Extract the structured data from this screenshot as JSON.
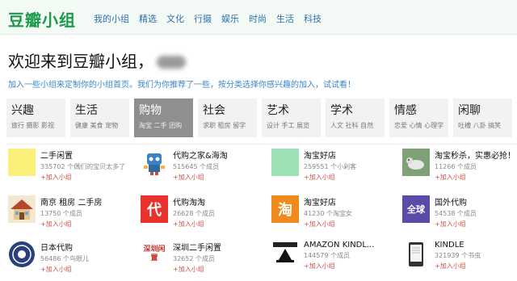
{
  "header": {
    "logo": "豆瓣小组",
    "nav": [
      "我的小组",
      "精选",
      "文化",
      "行摄",
      "娱乐",
      "时尚",
      "生活",
      "科技"
    ]
  },
  "welcome": {
    "title": "欢迎来到豆瓣小组，",
    "subtitle": "加入一些小组来定制你的小组首页。我们为你推荐了一些，按分类选择你感兴趣的加入，试试看！"
  },
  "categories": [
    {
      "name": "兴趣",
      "tags": "旅行 摄影 影视",
      "active": false
    },
    {
      "name": "生活",
      "tags": "健康 美食 宠物",
      "active": false
    },
    {
      "name": "购物",
      "tags": "淘宝 二手 团购",
      "active": true
    },
    {
      "name": "社会",
      "tags": "求职 租房 留学",
      "active": false
    },
    {
      "name": "艺术",
      "tags": "设计 手工 展览",
      "active": false
    },
    {
      "name": "学术",
      "tags": "人文 社科 自然",
      "active": false
    },
    {
      "name": "情感",
      "tags": "恋爱 心情 心理学",
      "active": false
    },
    {
      "name": "闲聊",
      "tags": "吐槽 八卦 搞笑",
      "active": false
    }
  ],
  "join_label": "+加入小组",
  "groups": [
    {
      "name": "二手闲置",
      "meta": "335702 个偶们的宝贝太多了",
      "thumb_color": "#fbf17a",
      "thumb_text": "",
      "icon": "yellow-square-icon"
    },
    {
      "name": "代购之家&海淘",
      "meta": "515645 个成员",
      "thumb_color": "#ffffff",
      "thumb_text": "",
      "icon": "robot-mascot-icon"
    },
    {
      "name": "淘宝好店",
      "meta": "259551 个小剁客",
      "thumb_color": "#9de0b6",
      "thumb_text": "",
      "icon": "green-square-icon"
    },
    {
      "name": "淘宝秒杀，实惠必抢！",
      "meta": "11266 个成员",
      "thumb_color": "#6f8f6a",
      "thumb_text": "",
      "icon": "dog-photo-icon"
    },
    {
      "name": "南京 租房 二手房",
      "meta": "13750 个成员",
      "thumb_color": "#f4e9d0",
      "thumb_text": "",
      "icon": "house-icon"
    },
    {
      "name": "代购淘淘",
      "meta": "26628 个成员",
      "thumb_color": "#e8322d",
      "thumb_text": "代",
      "icon": "dai-logo-icon"
    },
    {
      "name": "淘宝好店",
      "meta": "41230 个淘宝女",
      "thumb_color": "#f08a1c",
      "thumb_text": "淘",
      "icon": "taobao-logo-icon"
    },
    {
      "name": "国外代购",
      "meta": "54538 个成员",
      "thumb_color": "#5c4aa8",
      "thumb_text": "全球",
      "icon": "global-purchase-icon"
    },
    {
      "name": "日本代购",
      "meta": "56486 个鸟眼儿",
      "thumb_color": "#2b3f7a",
      "thumb_text": "",
      "icon": "japan-badge-icon"
    },
    {
      "name": "深圳二手闲置",
      "meta": "32652 个成员",
      "thumb_color": "#ffffff",
      "thumb_text": "深圳闲置",
      "icon": "shenzhen-text-icon"
    },
    {
      "name": "AMAZON KINDL...",
      "meta": "144579 个成员",
      "thumb_color": "#ffffff",
      "thumb_text": "",
      "icon": "amazon-kindle-icon"
    },
    {
      "name": "KINDLE",
      "meta": "321939 个书虫",
      "thumb_color": "#ffffff",
      "thumb_text": "",
      "icon": "kindle-device-icon"
    }
  ]
}
